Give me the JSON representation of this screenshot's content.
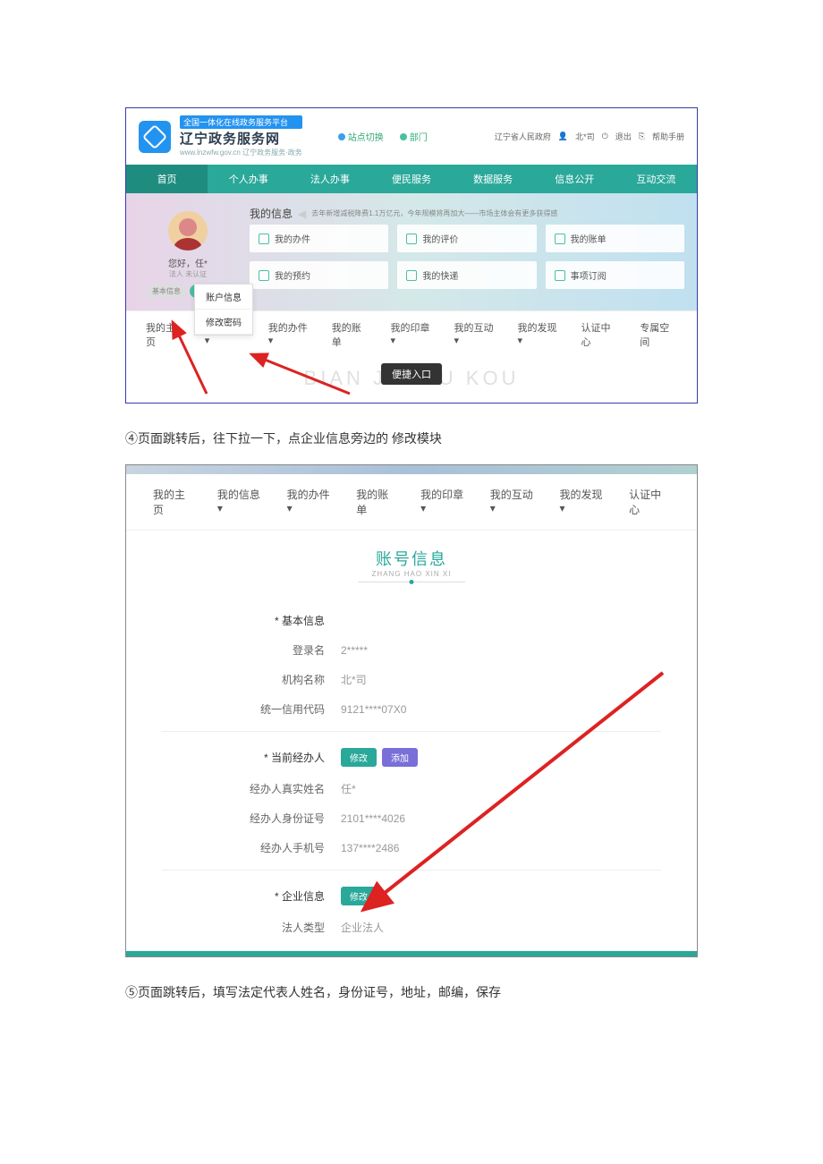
{
  "shot1": {
    "banner": "全国一体化在线政务服务平台",
    "site_title": "辽宁政务服务网",
    "site_sub": "www.lnzwfw.gov.cn  辽宁政务服务·政务",
    "switch_site": "站点切换",
    "dept": "部门",
    "top_right": {
      "gov": "辽宁省人民政府",
      "user": "北*司",
      "logout": "退出",
      "help": "帮助手册"
    },
    "nav": [
      "首页",
      "个人办事",
      "法人办事",
      "便民服务",
      "数据服务",
      "信息公开",
      "互动交流"
    ],
    "greeting": "您好，任*",
    "greeting_sub": "法人 未认证",
    "btn_basic": "基本信息",
    "btn_pwd": "修改密码",
    "my_info": "我的信息",
    "news": "去年新增减税降费1.1万亿元，今年规模将再加大——市场主体会有更多获得感",
    "cards": [
      "我的办件",
      "我的评价",
      "我的账单",
      "我的预约",
      "我的快递",
      "事项订阅"
    ],
    "subnav": [
      "我的主页",
      "我的信息▾",
      "我的办件▾",
      "我的账单",
      "我的印章▾",
      "我的互动▾",
      "我的发现▾",
      "认证中心",
      "专属空间"
    ],
    "dropdown": [
      "账户信息",
      "修改密码"
    ],
    "watermark": "BIAN JIE RU KOU",
    "entry": "便捷入口"
  },
  "instr1": "④页面跳转后，往下拉一下，点企业信息旁边的 修改模块",
  "shot2": {
    "nav": [
      "我的主页",
      "我的信息▾",
      "我的办件▾",
      "我的账单",
      "我的印章▾",
      "我的互动▾",
      "我的发现▾",
      "认证中心"
    ],
    "title": "账号信息",
    "title_pin": "ZHANG HAO XIN XI",
    "sec_basic": "基本信息",
    "login_label": "登录名",
    "login_val": "2*****",
    "org_label": "机构名称",
    "org_val": "北*司",
    "credit_label": "统一信用代码",
    "credit_val": "9121****07X0",
    "sec_agent": "当前经办人",
    "btn_modify": "修改",
    "btn_add": "添加",
    "agent_name_label": "经办人真实姓名",
    "agent_name_val": "任*",
    "agent_id_label": "经办人身份证号",
    "agent_id_val": "2101****4026",
    "agent_phone_label": "经办人手机号",
    "agent_phone_val": "137****2486",
    "sec_ent": "企业信息",
    "ent_type_label": "法人类型",
    "ent_type_val": "企业法人"
  },
  "instr2": "⑤页面跳转后，填写法定代表人姓名，身份证号，地址，邮编，保存"
}
